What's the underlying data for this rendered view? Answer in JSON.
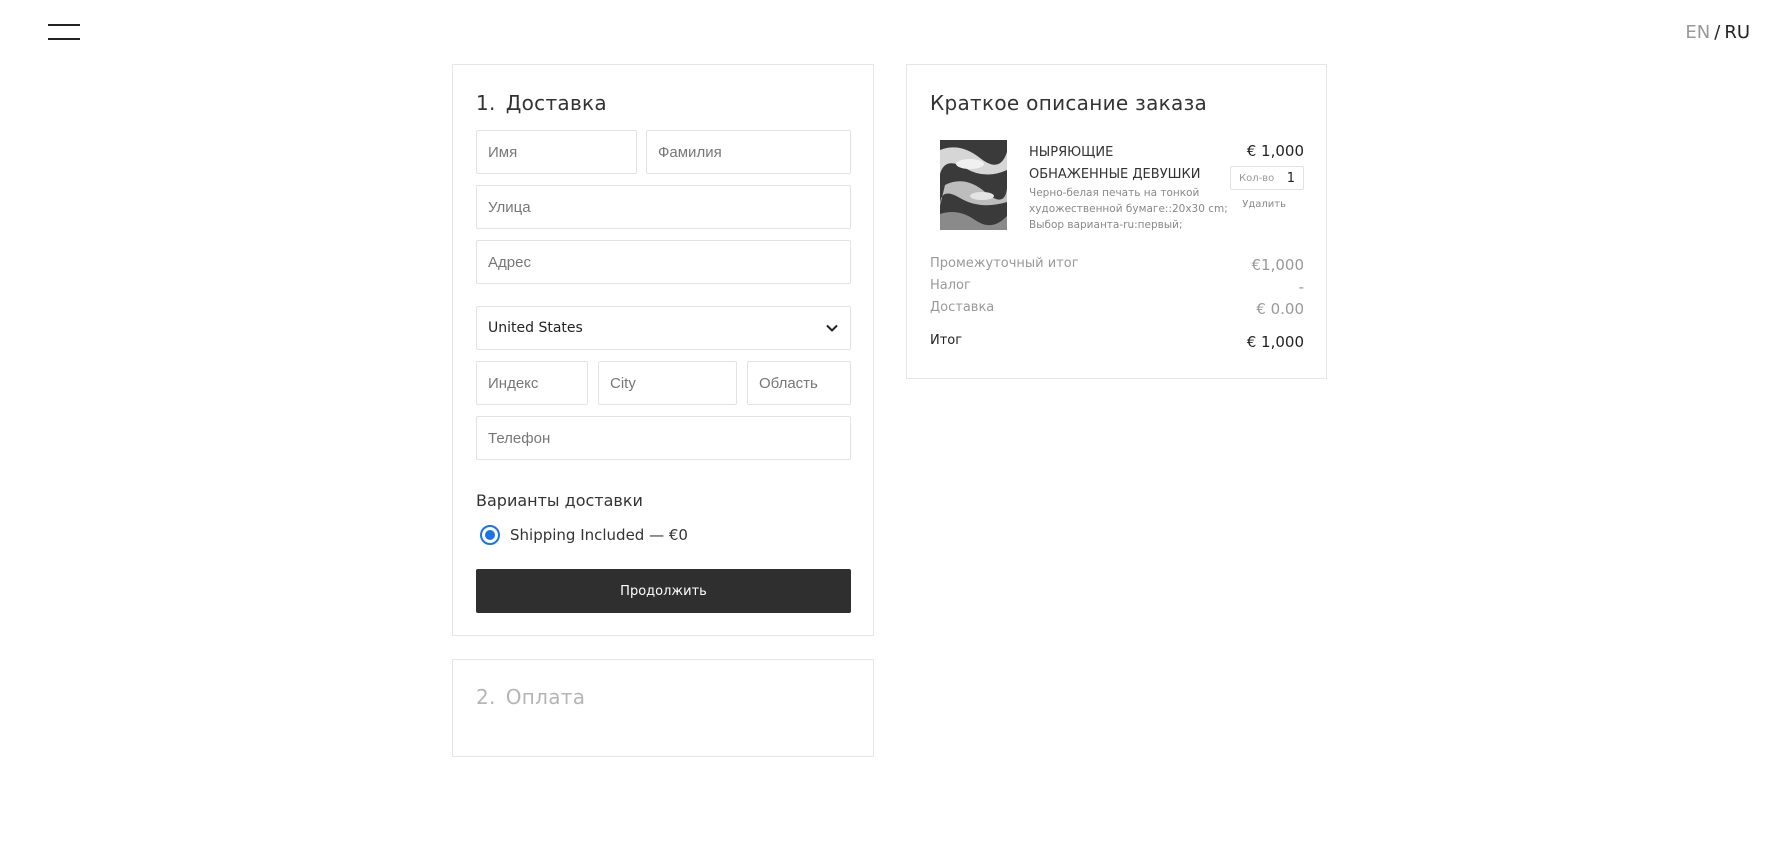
{
  "header": {
    "lang_en": "EN",
    "lang_separator": "/",
    "lang_ru": "RU",
    "menu_icon": "hamburger-menu-icon"
  },
  "delivery": {
    "step_number": "1.",
    "title": "Доставка",
    "fields": {
      "first_name_placeholder": "Имя",
      "last_name_placeholder": "Фамилия",
      "street_placeholder": "Улица",
      "address_placeholder": "Адрес",
      "country_value": "United States",
      "zip_placeholder": "Индекс",
      "city_placeholder": "City",
      "region_placeholder": "Область",
      "phone_placeholder": "Телефон"
    },
    "shipping_options_label": "Варианты доставки",
    "shipping_option": "Shipping Included — €0",
    "shipping_selected": true,
    "continue_label": "Продолжить"
  },
  "payment": {
    "step_number": "2.",
    "title": "Оплата"
  },
  "summary": {
    "title": "Краткое описание заказа",
    "item": {
      "name": "НЫРЯЮЩИЕ ОБНАЖЕННЫЕ ДЕВУШКИ",
      "description": "Черно-белая печать на тонкой художественной бумаге::20x30 cm; Выбор варианта-ru:первый;",
      "price": "€ 1,000",
      "qty_label": "Кол-во",
      "qty": "1",
      "remove_label": "Удалить"
    },
    "subtotal_label": "Промежуточный итог",
    "subtotal": "€1,000",
    "tax_label": "Налог",
    "tax": "-",
    "shipping_label": "Доставка",
    "shipping": "€ 0.00",
    "total_label": "Итог",
    "total": "€ 1,000"
  },
  "colors": {
    "accent_blue": "#1a73e8",
    "button_dark": "#2f2f2f",
    "muted_text": "#999999",
    "border": "#e2e2e2"
  }
}
